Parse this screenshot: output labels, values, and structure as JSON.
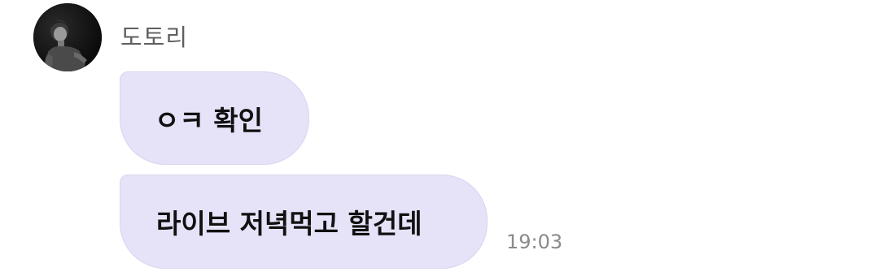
{
  "sender": {
    "name": "도토리",
    "avatar_icon": "profile-photo-person"
  },
  "messages": [
    {
      "text": "ㅇㅋ 확인"
    },
    {
      "text": "라이브 저녁먹고 할건데"
    }
  ],
  "timestamp": "19:03",
  "colors": {
    "bubble": "#e6e3f9",
    "bubble_border": "#d8d4f0",
    "name_text": "#5f5f5f",
    "time_text": "#8a8a8a"
  }
}
